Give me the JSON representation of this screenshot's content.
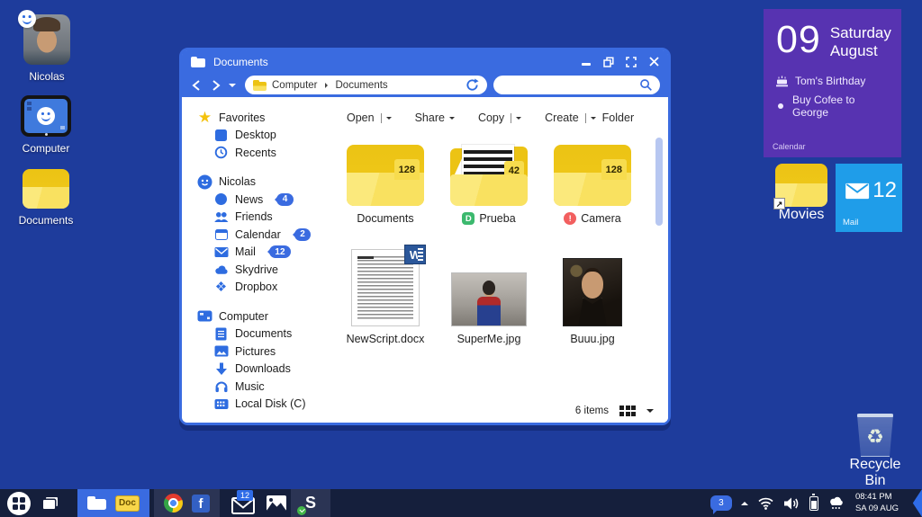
{
  "colors": {
    "accent": "#3a6be0",
    "desktop_bg": "#1e3c9c",
    "taskbar_bg": "#151f3c",
    "group_bg": "#2b3454",
    "calendar_purple": "#5733b1",
    "mail_blue": "#1f9de9",
    "badge_blue": "#3a6be0",
    "star_yellow": "#f4c20d",
    "icon_blue": "#2e6ce0",
    "folder_dark": "#ecc314",
    "folder_light": "#f9e160"
  },
  "glyphs": {
    "facebook": "f",
    "skype": "S",
    "word": "W",
    "dropbox_folder_badge": "D",
    "camera_alert": "!",
    "shortcut_arrow": "↗",
    "recycle": "♻",
    "star": "★",
    "dropbox": "❖"
  },
  "desktop": {
    "icons": [
      {
        "label": "Nicolas"
      },
      {
        "label": "Computer"
      },
      {
        "label": "Documents"
      }
    ],
    "recycle_bin_label": "Recycle Bin"
  },
  "tiles": {
    "calendar": {
      "day": "09",
      "weekday": "Saturday",
      "month": "August",
      "events": [
        {
          "text": "Tom's Birthday"
        },
        {
          "text": "Buy Cofee to George"
        }
      ],
      "app_label": "Calendar"
    },
    "movies_label": "Movies",
    "mail": {
      "count": "12",
      "label": "Mail"
    }
  },
  "window": {
    "title": "Documents",
    "nav": {
      "breadcrumb_root": "Computer",
      "breadcrumb_current": "Documents",
      "search_placeholder": ""
    },
    "toolbar": {
      "open": "Open",
      "share": "Share",
      "copy": "Copy",
      "create": "Create",
      "folder": "Folder"
    },
    "sidebar": {
      "sections": [
        {
          "label": "Favorites",
          "items": [
            {
              "label": "Desktop"
            },
            {
              "label": "Recents"
            }
          ]
        },
        {
          "label": "Nicolas",
          "items": [
            {
              "label": "News",
              "badge": "4"
            },
            {
              "label": "Friends"
            },
            {
              "label": "Calendar",
              "badge": "2"
            },
            {
              "label": "Mail",
              "badge": "12"
            },
            {
              "label": "Skydrive"
            },
            {
              "label": "Dropbox"
            }
          ]
        },
        {
          "label": "Computer",
          "items": [
            {
              "label": "Documents"
            },
            {
              "label": "Pictures"
            },
            {
              "label": "Downloads"
            },
            {
              "label": "Music"
            },
            {
              "label": "Local Disk (C)"
            }
          ]
        }
      ]
    },
    "files": [
      {
        "name": "Documents",
        "count": "128"
      },
      {
        "name": "Prueba",
        "count": "42"
      },
      {
        "name": "Camera",
        "count": "128"
      },
      {
        "name": "NewScript.docx"
      },
      {
        "name": "SuperMe.jpg"
      },
      {
        "name": "Buuu.jpg"
      }
    ],
    "status": {
      "items_text": "6 items"
    }
  },
  "taskbar": {
    "doc_badge": "Doc",
    "mail_badge": "12",
    "tray": {
      "bubble_count": "3",
      "time": "08:41 PM",
      "date": "SA 09 AUG"
    }
  }
}
